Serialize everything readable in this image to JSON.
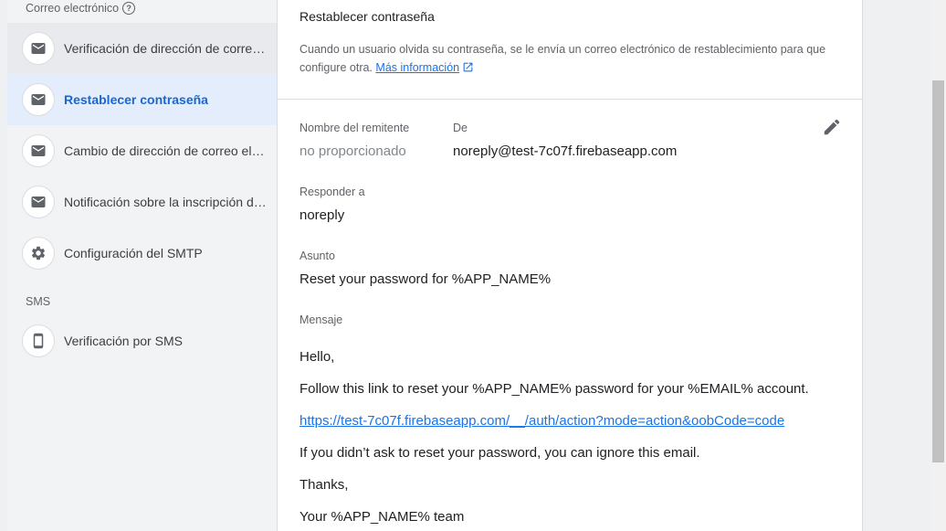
{
  "sidebar": {
    "email_section": "Correo electrónico",
    "email_help_glyph": "?",
    "sms_section": "SMS",
    "items": [
      {
        "label": "Verificación de dirección de correo electrónico",
        "icon": "mail-icon"
      },
      {
        "label": "Restablecer contraseña",
        "icon": "mail-icon"
      },
      {
        "label": "Cambio de dirección de correo electrónico",
        "icon": "mail-icon"
      },
      {
        "label": "Notificación sobre la inscripción de autenticación de varios factores",
        "icon": "mail-icon"
      },
      {
        "label": "Configuración del SMTP",
        "icon": "gear-icon"
      },
      {
        "label": "Verificación por SMS",
        "icon": "phone-icon"
      }
    ],
    "active_index": 1
  },
  "main": {
    "title": "Restablecer contraseña",
    "description": "Cuando un usuario olvida su contraseña, se le envía un correo electrónico de restablecimiento para que configure otra.",
    "more_info": "Más información",
    "sender_name_label": "Nombre del remitente",
    "sender_name_value": "no proporcionado",
    "from_label": "De",
    "from_value": "noreply@test-7c07f.firebaseapp.com",
    "reply_to_label": "Responder a",
    "reply_to_value": "noreply",
    "subject_label": "Asunto",
    "subject_value": "Reset your password for %APP_NAME%",
    "message_label": "Mensaje",
    "message": {
      "greeting": "Hello,",
      "line1": "Follow this link to reset your %APP_NAME% password for your %EMAIL% account.",
      "link": "https://test-7c07f.firebaseapp.com/__/auth/action?mode=action&oobCode=code",
      "line2": "If you didn’t ask to reset your password, you can ignore this email.",
      "thanks": "Thanks,",
      "signature": "Your %APP_NAME% team"
    }
  },
  "colors": {
    "accent": "#1a73e8",
    "active_bg": "#e3edfb",
    "nav_bg": "#f1f3f4"
  }
}
